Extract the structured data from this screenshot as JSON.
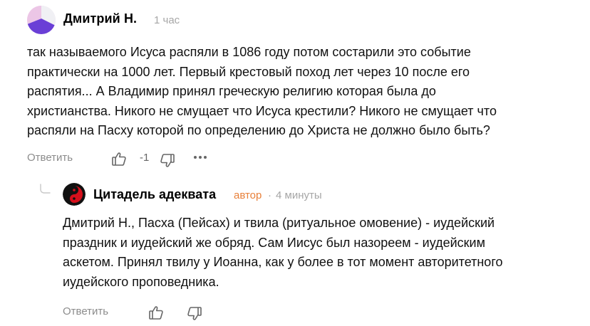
{
  "comment": {
    "author": "Дмитрий Н.",
    "time": "1 час",
    "lines": [
      "так называемого Исуса распяли в 1086 году потом состарили это событие",
      "практически на 1000 лет. Первый крестовый поход лет через 10 после его",
      "распятия... А Владимир принял греческую религию которая была до",
      "христианства. Никого не смущает что Исуса крестили? Никого не смущает что",
      "распяли на Пасху которой по определению до Христа не должно было быть?"
    ],
    "reply_label": "Ответить",
    "score": "-1",
    "like_icon": "thumbs-up-icon",
    "dislike_icon": "thumbs-down-icon",
    "more_icon": "more-dots-icon"
  },
  "reply": {
    "author": "Цитадель адеквата",
    "badge": "автор",
    "separator": "·",
    "time": "4 минуты",
    "lines": [
      "Дмитрий Н., Пасха (Пейсах) и твила (ритуальное омовение) - иудейский",
      "праздник и иудейский же обряд. Сам Иисус был назореем - иудейским",
      "аскетом. Принял твилу у Иоанна, как у более в тот момент авторитетного",
      "иудейского проповедника."
    ],
    "reply_label": "Ответить",
    "like_icon": "thumbs-up-icon",
    "dislike_icon": "thumbs-down-icon"
  },
  "colors": {
    "author_badge": "#e8803a",
    "muted": "#a6a6a6",
    "action_text": "#8c8c8c"
  }
}
